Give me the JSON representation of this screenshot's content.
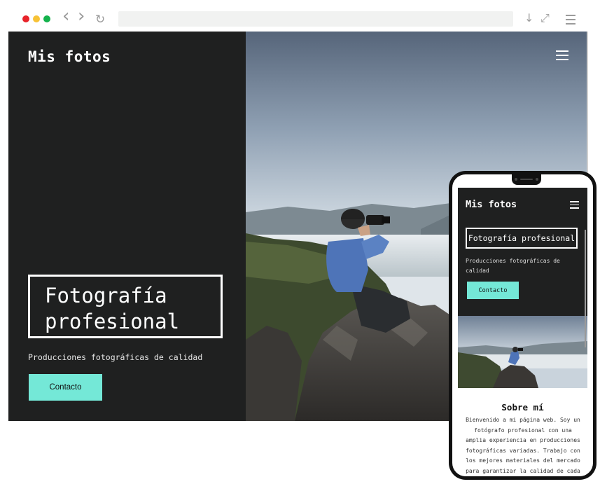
{
  "browser": {
    "dot_colors": [
      "#e8232a",
      "#f7c236",
      "#14b24c"
    ],
    "back_icon": "chevron-left-icon",
    "forward_icon": "chevron-right-icon",
    "reload_icon": "reload-icon",
    "download_icon": "download-icon",
    "expand_icon": "expand-icon",
    "menu_icon": "hamburger-icon",
    "back_glyph": "‹",
    "forward_glyph": "›",
    "reload_glyph": "↻",
    "download_glyph": "↓",
    "expand_glyph": "⤢"
  },
  "site": {
    "title": "Mis fotos",
    "hero_heading": "Fotografía profesional",
    "hero_subtitle": "Producciones fotográficas de calidad",
    "cta_label": "Contacto",
    "menu_icon": "hamburger-icon",
    "accent_color": "#74e8d7",
    "dark_bg": "#1f2020"
  },
  "mobile": {
    "title": "Mis fotos",
    "hero_heading": "Fotografía profesional",
    "hero_subtitle": "Producciones fotográficas de calidad",
    "cta_label": "Contacto",
    "about_heading": "Sobre mí",
    "about_text": "Bienvenido a mi página web. Soy un fotógrafo profesional con una amplia experiencia en producciones fotográficas variadas. Trabajo con los mejores materiales del mercado para garantizar la calidad de cada"
  }
}
